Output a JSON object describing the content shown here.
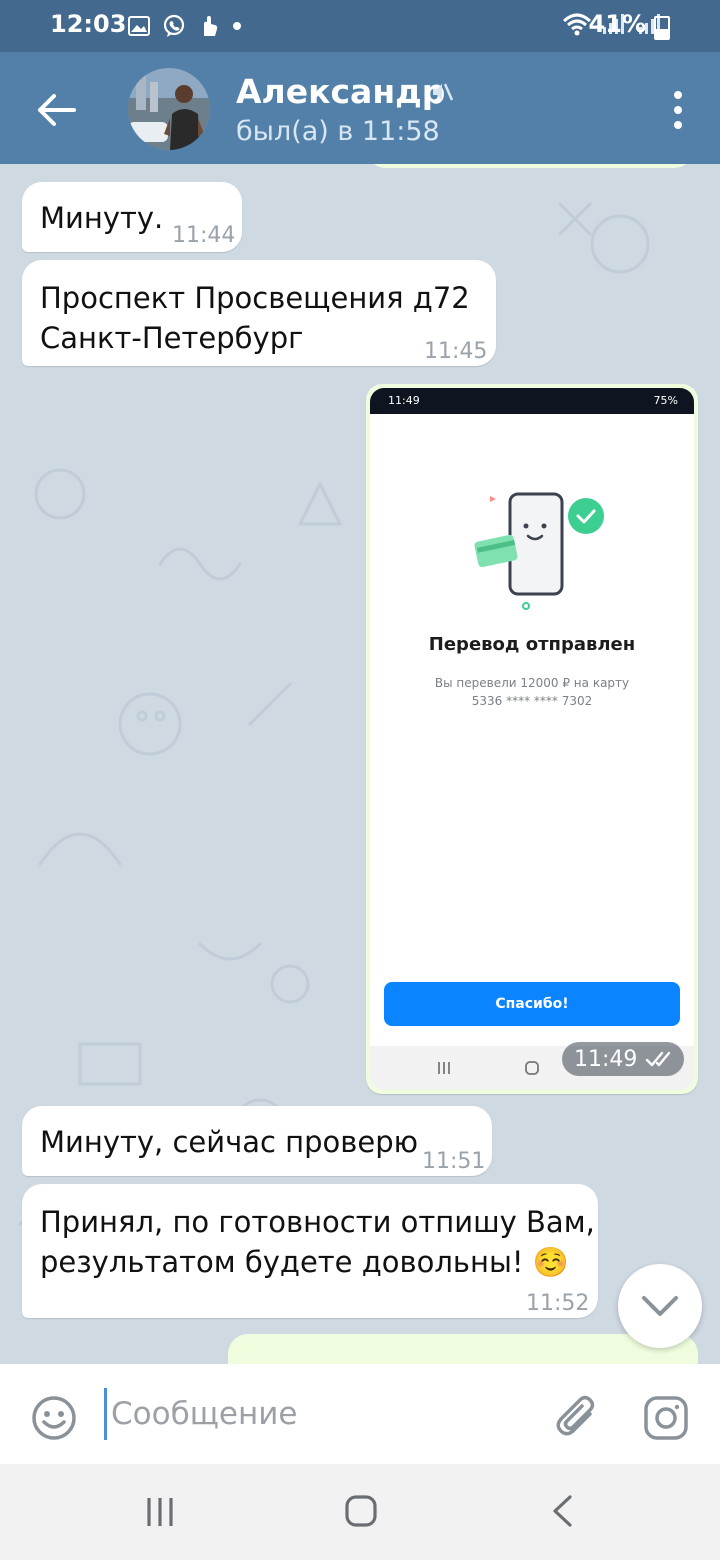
{
  "status_bar": {
    "time": "12:03",
    "battery": "41%"
  },
  "header": {
    "contact_name": "Александр",
    "contact_status": "был(а) в 11:58"
  },
  "messages": [
    {
      "text": "Минуту.",
      "time": "11:44"
    },
    {
      "text": "Проспект Просвещения д72\nСанкт-Петербург",
      "time": "11:45"
    },
    {
      "text": "Минуту, сейчас проверю",
      "time": "11:51"
    },
    {
      "text": "Принял, по готовности отпишу Вам,\nрезультатом будете довольны! ☺️",
      "time": "11:52"
    }
  ],
  "photo_message": {
    "time": "11:49",
    "screenshot": {
      "status_time": "11:49",
      "status_battery": "75%",
      "title": "Перевод отправлен",
      "subtitle": "Вы перевели 12000 ₽ на карту\n5336 **** **** 7302",
      "button_label": "Спасибо!"
    }
  },
  "input": {
    "placeholder": "Сообщение"
  },
  "colors": {
    "header": "#5280a8",
    "status_bar": "#44698f",
    "chat_bg": "#cfd9e2",
    "outgoing_bubble": "#effdde",
    "incoming_bubble": "#ffffff",
    "accent": "#0a84ff"
  }
}
